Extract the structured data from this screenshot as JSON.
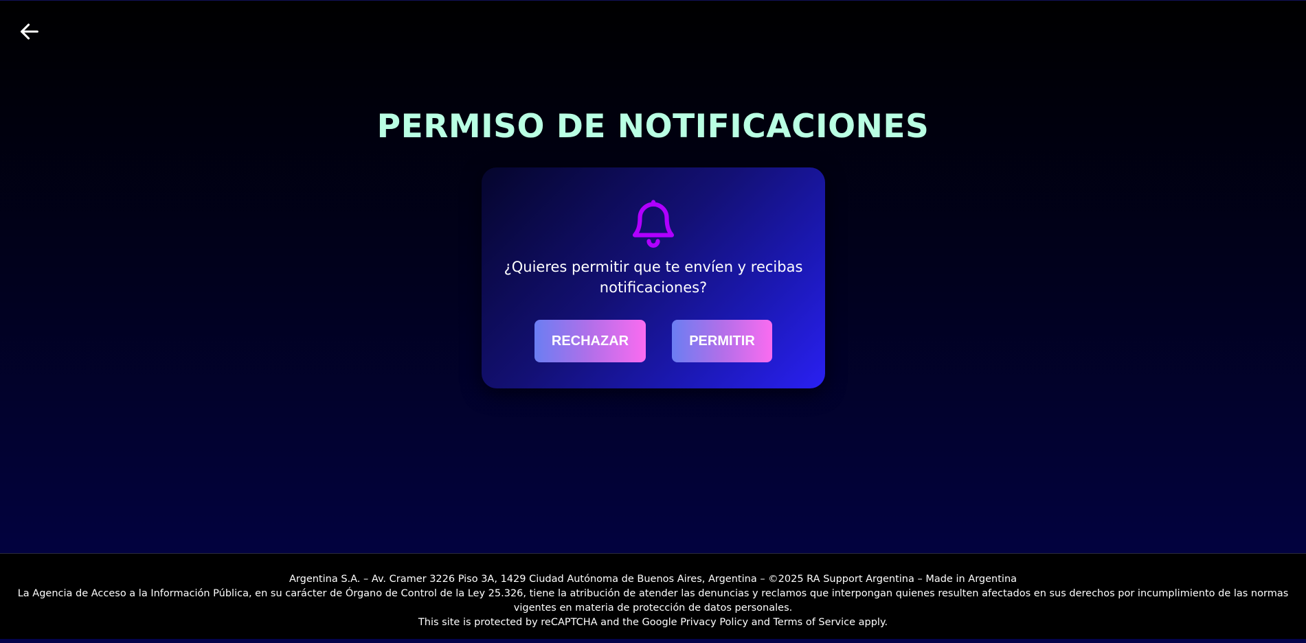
{
  "nav": {
    "back_icon": "arrow-left-icon"
  },
  "page": {
    "title": "PERMISO DE NOTIFICACIONES"
  },
  "dialog": {
    "icon": "bell-icon",
    "icon_color": "#b000ff",
    "question": "¿Quieres permitir que te envíen y recibas notificaciones?",
    "reject_label": "RECHAZAR",
    "allow_label": "PERMITIR"
  },
  "footer": {
    "line1": "Argentina S.A. – Av. Cramer 3226 Piso 3A, 1429 Ciudad Autónoma de Buenos Aires, Argentina – ©2025 RA Support Argentina – Made in Argentina",
    "line2": "La Agencia de Acceso a la Información Pública, en su carácter de Órgano de Control de la Ley 25.326, tiene la atribución de atender las denuncias y reclamos que interpongan quienes resulten afectados en sus derechos por incumplimiento de las normas vigentes en materia de protección de datos personales.",
    "line3": "This site is protected by reCAPTCHA and the Google Privacy Policy and Terms of Service apply."
  },
  "colors": {
    "title": "#b9ffe3",
    "button_gradient_start": "#6b7ef2",
    "button_gradient_end": "#fa6cf0"
  }
}
